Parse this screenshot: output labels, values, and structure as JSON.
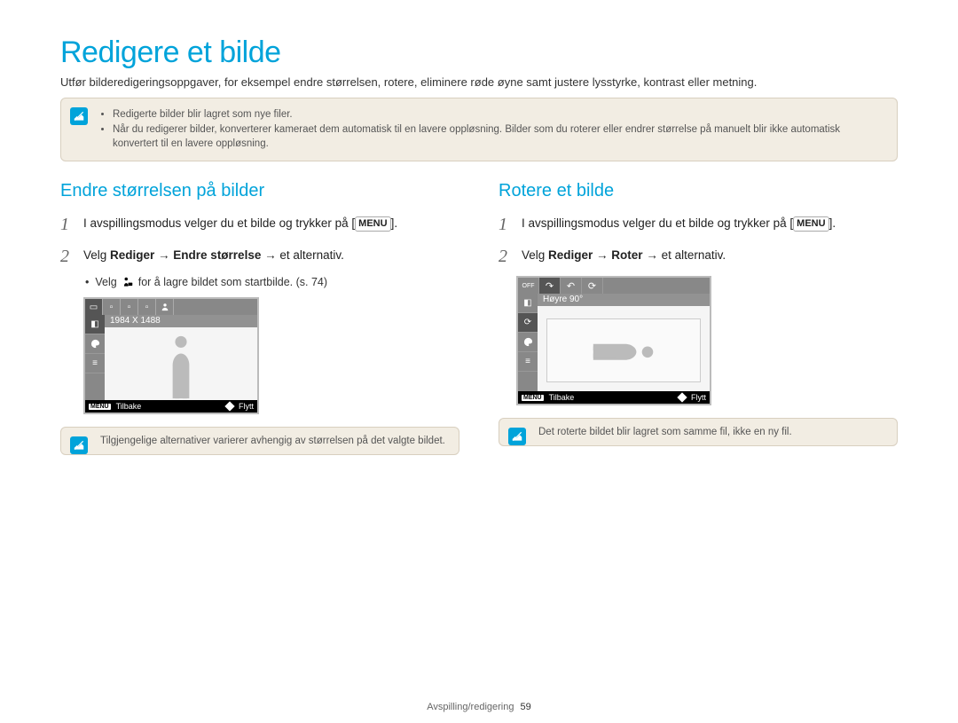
{
  "title": "Redigere et bilde",
  "intro": "Utfør bilderedigeringsoppgaver, for eksempel endre størrelsen, rotere, eliminere røde øyne samt justere lysstyrke, kontrast eller metning.",
  "top_note": {
    "items": [
      "Redigerte bilder blir lagret som nye filer.",
      "Når du redigerer bilder, konverterer kameraet dem automatisk til en lavere oppløsning. Bilder som du roterer eller endrer størrelse på manuelt blir ikke automatisk konvertert til en lavere oppløsning."
    ]
  },
  "left": {
    "heading": "Endre størrelsen på bilder",
    "step1": {
      "num": "1",
      "text_a": "I avspillingsmodus velger du et bilde og trykker på ",
      "menu": "MENU",
      "text_b": "."
    },
    "step2": {
      "num": "2",
      "text_a": "Velg ",
      "bold": "Rediger → Endre størrelse",
      "text_b": " → et alternativ."
    },
    "sub_a": "Velg ",
    "sub_b": " for å lagre bildet som startbilde. (s. 74)",
    "lcd": {
      "label": "1984 X 1488",
      "back_btn": "MENU",
      "back": "Tilbake",
      "move": "Flytt"
    },
    "note": "Tilgjengelige alternativer varierer avhengig av størrelsen på det valgte bildet."
  },
  "right": {
    "heading": "Rotere et bilde",
    "step1": {
      "num": "1",
      "text_a": "I avspillingsmodus velger du et bilde og trykker på ",
      "menu": "MENU",
      "text_b": "."
    },
    "step2": {
      "num": "2",
      "text_a": "Velg ",
      "bold": "Rediger → Roter",
      "text_b": " → et alternativ."
    },
    "lcd": {
      "off": "OFF",
      "label": "Høyre 90°",
      "back_btn": "MENU",
      "back": "Tilbake",
      "move": "Flytt"
    },
    "note": "Det roterte bildet blir lagret som samme fil, ikke en ny fil."
  },
  "footer": {
    "section": "Avspilling/redigering",
    "page": "59"
  }
}
